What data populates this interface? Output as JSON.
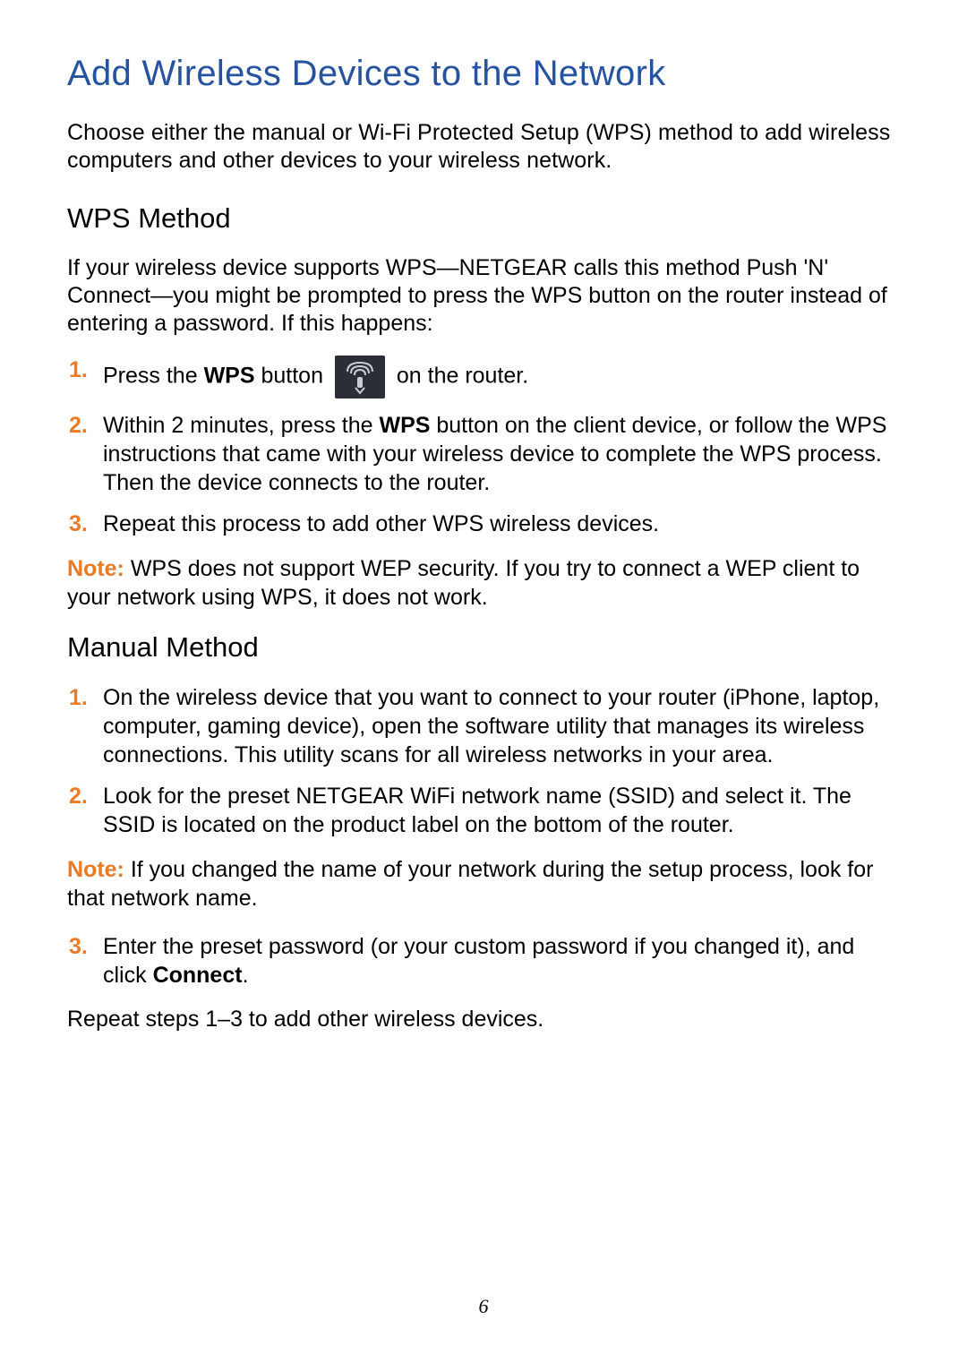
{
  "title": "Add Wireless Devices to the Network",
  "intro": "Choose either the manual or Wi-Fi Protected Setup (WPS) method to add wireless computers and other devices to your wireless network.",
  "wps": {
    "heading": "WPS Method",
    "intro": "If your wireless device supports WPS—NETGEAR calls this method Push 'N' Connect—you might be prompted to press the WPS button on the router instead of entering a password. If this happens:",
    "step1_pre": "Press the ",
    "step1_bold": "WPS",
    "step1_mid": " button ",
    "step1_post": " on the router.",
    "step2_pre": "Within 2 minutes, press the ",
    "step2_bold": "WPS",
    "step2_post": " button on the client device, or follow the WPS instructions that came with your wireless device to complete the WPS process. Then the device connects to the router.",
    "step3": "Repeat this process to add other WPS wireless devices.",
    "note_label": "Note:  ",
    "note_text": "WPS does not support WEP security. If you try to connect a WEP client to your network using WPS, it does not work."
  },
  "manual": {
    "heading": "Manual Method",
    "step1": "On the wireless device that you want to connect to your router (iPhone, laptop, computer, gaming device), open the software utility that manages its wireless connections. This utility scans for all wireless networks in your area.",
    "step2": "Look for the preset NETGEAR WiFi network name (SSID) and select it. The SSID is located on the product label on the bottom of the router.",
    "note_label": "Note:  ",
    "note_text": "If you changed the name of your network during the setup process, look for that network name.",
    "step3_pre": "Enter the preset password (or your custom password if you changed it), and click ",
    "step3_bold": "Connect",
    "step3_post": ".",
    "closing": "Repeat steps 1–3 to add other wireless devices."
  },
  "numbers": {
    "n1": "1.",
    "n2": "2.",
    "n3": "3."
  },
  "page_number": "6"
}
